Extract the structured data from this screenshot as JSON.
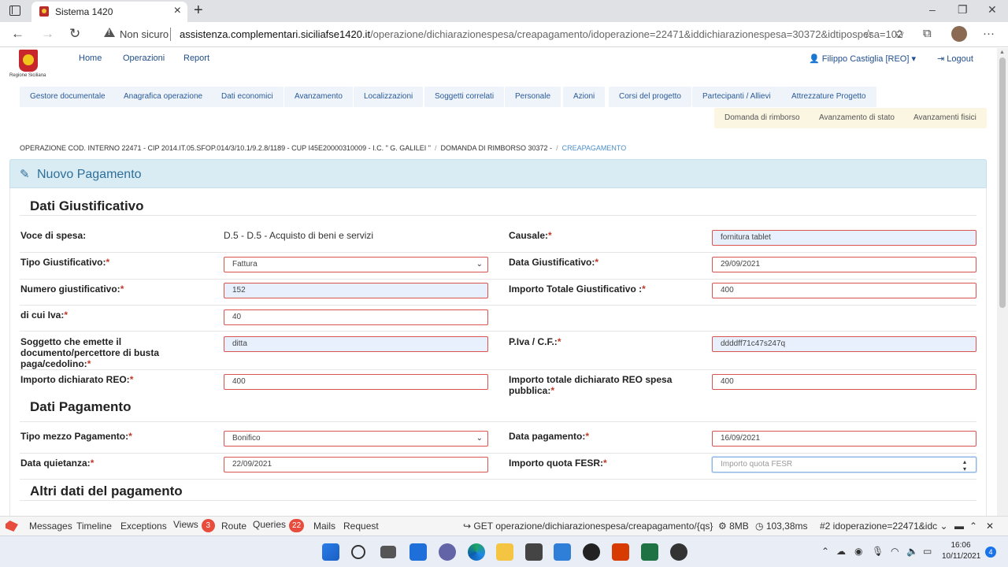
{
  "browser": {
    "tab_title": "Sistema 1420",
    "security_label": "Non sicuro",
    "url_host": "assistenza.complementari.siciliafse1420.it",
    "url_path": "/operazione/dichiarazionespesa/creapagamento/idoperazione=22471&iddichiarazionespesa=30372&idtipospesa=102"
  },
  "header": {
    "logo_text": "Regione Siciliana",
    "nav": [
      "Home",
      "Operazioni",
      "Report"
    ],
    "user": "Filippo Castiglia [REO]",
    "logout": "Logout"
  },
  "tabs_row1": [
    "Gestore documentale",
    "Anagrafica operazione",
    "Dati economici",
    "Avanzamento",
    "Localizzazioni",
    "Soggetti correlati",
    "Personale",
    "Azioni",
    "Corsi del progetto",
    "Partecipanti / Allievi",
    "Attrezzature Progetto"
  ],
  "tabs_row2": [
    "Domanda di rimborso",
    "Avanzamento di stato",
    "Avanzamenti fisici"
  ],
  "breadcrumb": {
    "item1": "OPERAZIONE COD. INTERNO 22471 - CIP 2014.IT.05.SFOP.014/3/10.1/9.2.8/1189 - CUP I45E20000310009 - I.C. \" G. GALILEI \"",
    "item2": "DOMANDA DI RIMBORSO 30372 -",
    "item3": "CREAPAGAMENTO"
  },
  "panel": {
    "title": "Nuovo Pagamento"
  },
  "sections": {
    "giustificativo": "Dati Giustificativo",
    "pagamento": "Dati Pagamento",
    "altri": "Altri dati del pagamento"
  },
  "form": {
    "voce_label": "Voce di spesa:",
    "voce_value": "D.5 - D.5 - Acquisto di beni e servizi",
    "causale_label": "Causale:",
    "causale_value": "fornitura tablet",
    "tipo_giust_label": "Tipo Giustificativo:",
    "tipo_giust_value": "Fattura",
    "data_giust_label": "Data Giustificativo:",
    "data_giust_value": "29/09/2021",
    "numero_label": "Numero giustificativo:",
    "numero_value": "152",
    "importo_tot_label": "Importo Totale Giustificativo :",
    "importo_tot_value": "400",
    "iva_label": "di cui Iva:",
    "iva_value": "40",
    "soggetto_label": "Soggetto che emette il documento/percettore di busta paga/cedolino:",
    "soggetto_value": "ditta",
    "piva_label": "P.Iva / C.F.:",
    "piva_value": "ddddff71c47s247q",
    "imp_reo_label": "Importo dichiarato REO:",
    "imp_reo_value": "400",
    "imp_tot_reo_label": "Importo totale dichiarato REO spesa pubblica:",
    "imp_tot_reo_value": "400",
    "tipo_mezzo_label": "Tipo mezzo Pagamento:",
    "tipo_mezzo_value": "Bonifico",
    "data_pag_label": "Data pagamento:",
    "data_pag_value": "16/09/2021",
    "data_quiet_label": "Data quietanza:",
    "data_quiet_value": "22/09/2021",
    "fesr_label": "Importo quota FESR:",
    "fesr_placeholder": "Importo quota FESR"
  },
  "debugbar": {
    "messages": "Messages",
    "timeline": "Timeline",
    "exceptions": "Exceptions",
    "views": "Views",
    "views_count": "3",
    "route": "Route",
    "queries": "Queries",
    "queries_count": "22",
    "mails": "Mails",
    "request": "Request",
    "request_path": "GET operazione/dichiarazionespesa/creapagamento/{qs}",
    "memory": "8MB",
    "time": "103,38ms",
    "request_select": "#2 idoperazione=22471&idc"
  },
  "taskbar": {
    "time": "16:06",
    "date": "10/11/2021",
    "notifications": "4"
  },
  "colors": {
    "required": "#c0392b",
    "link": "#1f4e8c",
    "panel_head": "#d9ecf4",
    "badge": "#e74c3c"
  }
}
